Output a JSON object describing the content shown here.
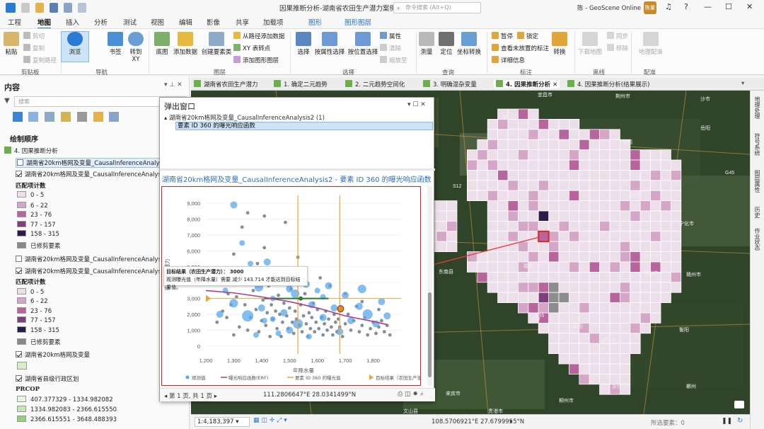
{
  "window": {
    "title": "因果推断分析-湖南省农田生产潜力案例",
    "search_placeholder": "命令搜索 (Alt+Q)",
    "user": "陈 - GeoScene Online",
    "avatar": "陈量"
  },
  "tabs": [
    "工程",
    "地图",
    "插入",
    "分析",
    "测试",
    "视图",
    "编辑",
    "影像",
    "共享",
    "加载项",
    "图形",
    "图形图层"
  ],
  "ribbon": {
    "clipboard": {
      "paste": "粘贴",
      "cut": "剪切",
      "copy": "复制",
      "copy_path": "复制路径",
      "group": "剪贴板"
    },
    "nav": {
      "explore": "浏览",
      "bookmarks": "书签",
      "goto": "转到\nXY",
      "group": "导航"
    },
    "layer": {
      "basemap": "底图",
      "add_data": "添加数据",
      "create_features": "创建要素类",
      "add_from_path": "从路径添加数据",
      "xy_points": "XY 表转点",
      "add_graphics": "添加图形图层",
      "group": "图层"
    },
    "selection": {
      "select": "选择",
      "by_attr": "按属性选择",
      "by_loc": "按位置选择",
      "attributes": "属性",
      "clear": "清除",
      "zoom_to": "缩放至",
      "group": "选择"
    },
    "inquiry": {
      "measure": "测量",
      "locate": "定位",
      "coords": "坐标转换",
      "group": "查询"
    },
    "labeling": {
      "pause": "暂停",
      "lock": "锁定",
      "view_unplaced": "查看未放置的标注",
      "more": "详细信息",
      "convert": "转换",
      "group": "标注"
    },
    "offline": {
      "download": "下载地图",
      "sync": "同步",
      "remove": "移除",
      "group": "离线"
    },
    "delivery": {
      "geo": "地理配准",
      "group": "配准"
    }
  },
  "contents": {
    "title": "内容",
    "search_placeholder": "搜索",
    "draw_order": "绘制顺序",
    "map_name": "4. 因果推断分析",
    "layer1": "湖南省20km格网及变量_CausalInferenceAnalysi…",
    "layer2": "湖南省20km格网及变量_CausalInferenceAnalysi…",
    "legend_title": "匹配项计数",
    "legend": [
      {
        "label": "0 - 5",
        "color": "#ecdfe9"
      },
      {
        "label": "6 - 22",
        "color": "#d5a6c8"
      },
      {
        "label": "23 - 76",
        "color": "#b8659d"
      },
      {
        "label": "77 - 157",
        "color": "#7e3f7e"
      },
      {
        "label": "158 - 315",
        "color": "#2c1a4d"
      }
    ],
    "clipped": "已修剪要素",
    "layer3": "湖南省20km格网及变量_CausalInferenceAnalysi…",
    "layer4": "湖南省20km格网及变量_CausalInferenceAnalysi…",
    "legend_title2": "匹配项计数",
    "legend2": [
      {
        "label": "0 - 5",
        "color": "#ecdfe9"
      },
      {
        "label": "6 - 22",
        "color": "#d5a6c8"
      },
      {
        "label": "23 - 76",
        "color": "#b8659d"
      },
      {
        "label": "77 - 157",
        "color": "#7e3f7e"
      },
      {
        "label": "158 - 315",
        "color": "#2c1a4d"
      }
    ],
    "clipped2": "已修剪要素",
    "layer5": "湖南省20km格网及变量",
    "layer6": "湖南省县级行政区划",
    "prcop_title": "PRCOP",
    "prcop": [
      {
        "label": "407.377329 - 1334.982082",
        "color": "#e9f5df"
      },
      {
        "label": "1334.982083 - 2366.615550",
        "color": "#c8e6b0"
      },
      {
        "label": "2366.615551 - 3648.488393",
        "color": "#96cf7a"
      }
    ]
  },
  "map_tabs": [
    "湖南省农田生产潜力",
    "1. 确定二元趋势",
    "2. 二元趋势空间化",
    "3. 明确混杂变量",
    "4. 因果推断分析",
    "4. 因果推断分析(结果展示)"
  ],
  "right_tabs": [
    "地理处理",
    "符号系统",
    "图层属性",
    "历史",
    "作业状态"
  ],
  "map_labels": [
    "荆州市",
    "沙市",
    "常德",
    "岳阳",
    "宜昌市",
    "荆门",
    "G45",
    "S12",
    "益阳",
    "娄底",
    "东南县",
    "衡阳",
    "邵阳",
    "G55",
    "永州",
    "郴州",
    "桂林市",
    "柳州市",
    "贵港市",
    "来宾市",
    "宁化市",
    "文山县",
    "漳州市",
    "赣州市",
    "G59",
    "吉安市"
  ],
  "popup": {
    "title": "弹出窗口",
    "tree_parent": "湖南省20km格网及变量_CausalInferenceAnalysis2 (1)",
    "tree_child": "要素 ID 360 的曝光响应函数",
    "chart_heading": "湖南省20km格网及变量_CausalInferenceAnalysis2 - 要素 ID 360 的曝光响应函数",
    "footer_nav": "◂ 第 1 页, 共 1 页 ▸",
    "footer_coords": "111.2806647°E 28.0341499°N",
    "tooltip_l1": "目标结果（农田生产潜力）：  3000",
    "tooltip_l2": "观测曝光值（年降水量）需要 减少 143.714 才能达到目标结果值。"
  },
  "status": {
    "scale": "1:4,183,397",
    "coords": "108.5706921°E 27.6799955°N",
    "selected": "所选要素：0"
  },
  "chart_data": {
    "type": "scatter",
    "title": "",
    "xlabel": "年降水量",
    "ylabel": "农田生产潜力",
    "xlim": [
      1200,
      1900
    ],
    "ylim": [
      -500,
      9500
    ],
    "x_ticks": [
      1200,
      1300,
      1400,
      1500,
      1600,
      1700,
      1800
    ],
    "y_ticks": [
      0,
      1000,
      2000,
      3000,
      4000,
      5000,
      6000,
      7000,
      8000,
      9000
    ],
    "legend": [
      "观测值",
      "曝光响应函数(ERF)",
      "要素 ID 360 的曝光值",
      "目标结果（农田生产潜力）"
    ],
    "legend_position": "bottom",
    "erf": {
      "x": [
        1200,
        1300,
        1400,
        1500,
        1600,
        1700,
        1800,
        1850
      ],
      "y": [
        3500,
        3350,
        3100,
        2800,
        2400,
        1900,
        1550,
        1350
      ]
    },
    "exposure_x": [
      1530,
      1680
    ],
    "target_y": 3000,
    "target_point": {
      "x": 1683,
      "y": 2350
    },
    "target_exposure": {
      "x": 1540,
      "y": 3000
    },
    "observations": [
      [
        1240,
        1500
      ],
      [
        1260,
        2200
      ],
      [
        1275,
        1800
      ],
      [
        1290,
        2600
      ],
      [
        1300,
        700
      ],
      [
        1310,
        3100
      ],
      [
        1320,
        1200
      ],
      [
        1330,
        4200
      ],
      [
        1340,
        2600
      ],
      [
        1350,
        1000
      ],
      [
        1360,
        1800
      ],
      [
        1370,
        3500
      ],
      [
        1380,
        2300
      ],
      [
        1385,
        5200
      ],
      [
        1390,
        900
      ],
      [
        1400,
        1600
      ],
      [
        1405,
        2900
      ],
      [
        1410,
        6200
      ],
      [
        1415,
        1300
      ],
      [
        1420,
        2100
      ],
      [
        1425,
        3800
      ],
      [
        1430,
        600
      ],
      [
        1435,
        2600
      ],
      [
        1440,
        1700
      ],
      [
        1445,
        4500
      ],
      [
        1450,
        2200
      ],
      [
        1455,
        1100
      ],
      [
        1460,
        3200
      ],
      [
        1465,
        2000
      ],
      [
        1470,
        600
      ],
      [
        1475,
        1500
      ],
      [
        1480,
        2700
      ],
      [
        1485,
        7800
      ],
      [
        1490,
        1900
      ],
      [
        1495,
        1100
      ],
      [
        1500,
        2400
      ],
      [
        1505,
        3600
      ],
      [
        1510,
        1500
      ],
      [
        1515,
        800
      ],
      [
        1520,
        2200
      ],
      [
        1525,
        1700
      ],
      [
        1530,
        5600
      ],
      [
        1535,
        1300
      ],
      [
        1540,
        2600
      ],
      [
        1545,
        900
      ],
      [
        1550,
        1900
      ],
      [
        1555,
        3300
      ],
      [
        1560,
        1400
      ],
      [
        1565,
        600
      ],
      [
        1570,
        2100
      ],
      [
        1575,
        1100
      ],
      [
        1580,
        1800
      ],
      [
        1585,
        2700
      ],
      [
        1590,
        900
      ],
      [
        1595,
        1500
      ],
      [
        1600,
        2300
      ],
      [
        1605,
        1100
      ],
      [
        1610,
        4300
      ],
      [
        1615,
        1800
      ],
      [
        1620,
        700
      ],
      [
        1625,
        1400
      ],
      [
        1630,
        2200
      ],
      [
        1635,
        1000
      ],
      [
        1640,
        1700
      ],
      [
        1645,
        3800
      ],
      [
        1650,
        1200
      ],
      [
        1655,
        700
      ],
      [
        1660,
        2000
      ],
      [
        1665,
        1500
      ],
      [
        1670,
        900
      ],
      [
        1675,
        1700
      ],
      [
        1680,
        1200
      ],
      [
        1690,
        600
      ],
      [
        1700,
        1400
      ],
      [
        1710,
        2000
      ],
      [
        1720,
        1000
      ],
      [
        1730,
        1600
      ],
      [
        1740,
        2500
      ],
      [
        1750,
        900
      ],
      [
        1760,
        1300
      ],
      [
        1770,
        1800
      ],
      [
        1780,
        700
      ],
      [
        1790,
        1100
      ],
      [
        1800,
        1500
      ],
      [
        1810,
        800
      ],
      [
        1820,
        1200
      ],
      [
        1830,
        1600
      ],
      [
        1840,
        900
      ],
      [
        1850,
        1300
      ],
      [
        1860,
        700
      ],
      [
        1330,
        7500
      ],
      [
        1350,
        8400
      ],
      [
        1410,
        8200
      ],
      [
        1300,
        5800
      ],
      [
        1280,
        3300
      ],
      [
        1420,
        4900
      ],
      [
        1550,
        4200
      ],
      [
        1700,
        3300
      ],
      [
        1760,
        2800
      ],
      [
        1820,
        2300
      ]
    ],
    "bubbles": [
      [
        1300,
        8900,
        5
      ],
      [
        1340,
        4500,
        5
      ],
      [
        1390,
        3700,
        6
      ],
      [
        1330,
        6500,
        4
      ],
      [
        1420,
        5300,
        5
      ],
      [
        1460,
        4200,
        4
      ],
      [
        1500,
        3600,
        5
      ],
      [
        1520,
        3300,
        6
      ],
      [
        1560,
        3900,
        5
      ],
      [
        1600,
        3500,
        4
      ],
      [
        1640,
        3800,
        5
      ],
      [
        1700,
        3200,
        5
      ],
      [
        1760,
        3600,
        6
      ],
      [
        1830,
        2800,
        5
      ],
      [
        1300,
        2700,
        6
      ],
      [
        1350,
        1900,
        8
      ],
      [
        1400,
        2400,
        5
      ],
      [
        1440,
        1700,
        4
      ],
      [
        1480,
        2100,
        5
      ],
      [
        1530,
        1400,
        7
      ],
      [
        1580,
        2600,
        5
      ],
      [
        1620,
        1800,
        5
      ],
      [
        1660,
        2400,
        5
      ],
      [
        1720,
        1600,
        5
      ],
      [
        1780,
        2000,
        7
      ],
      [
        1810,
        1400,
        5
      ],
      [
        1270,
        3500,
        4
      ],
      [
        1440,
        3000,
        4
      ],
      [
        1460,
        800,
        4
      ],
      [
        1680,
        900,
        5
      ],
      [
        1570,
        600,
        4
      ],
      [
        1360,
        5200,
        4
      ],
      [
        1300,
        4000,
        5
      ],
      [
        1750,
        2500,
        5
      ],
      [
        1500,
        1000,
        5
      ],
      [
        1410,
        1600,
        4
      ],
      [
        1620,
        3100,
        4
      ],
      [
        1250,
        2000,
        5
      ],
      [
        1850,
        1900,
        5
      ],
      [
        1380,
        700,
        4
      ]
    ]
  }
}
